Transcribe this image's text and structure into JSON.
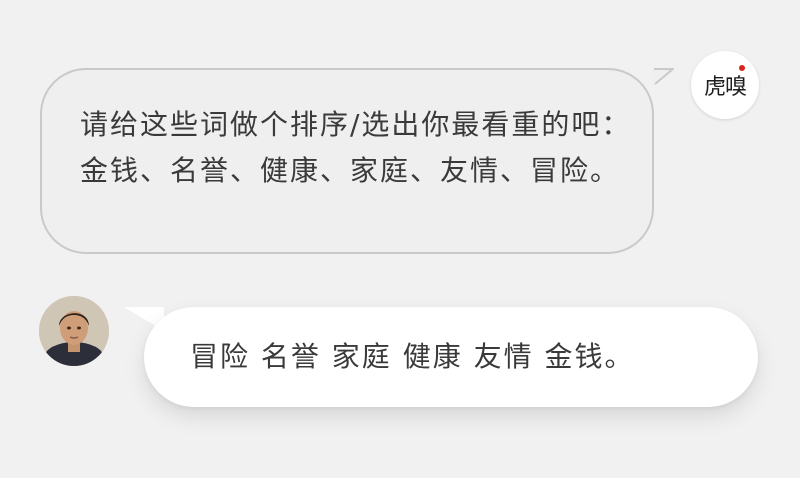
{
  "conversation": {
    "question": {
      "sender_label": "虎嗅",
      "text": "请给这些词做个排序/选出你最看重的吧：金钱、名誉、健康、家庭、友情、冒险。"
    },
    "answer": {
      "text": "冒险 名誉 家庭 健康 友情 金钱。"
    }
  },
  "colors": {
    "background": "#f1f1f1",
    "question_bubble": "#efefef",
    "question_border": "#c9c9c9",
    "answer_bubble": "#ffffff",
    "text": "#3a3a3a",
    "brand_accent": "#d9261c"
  }
}
